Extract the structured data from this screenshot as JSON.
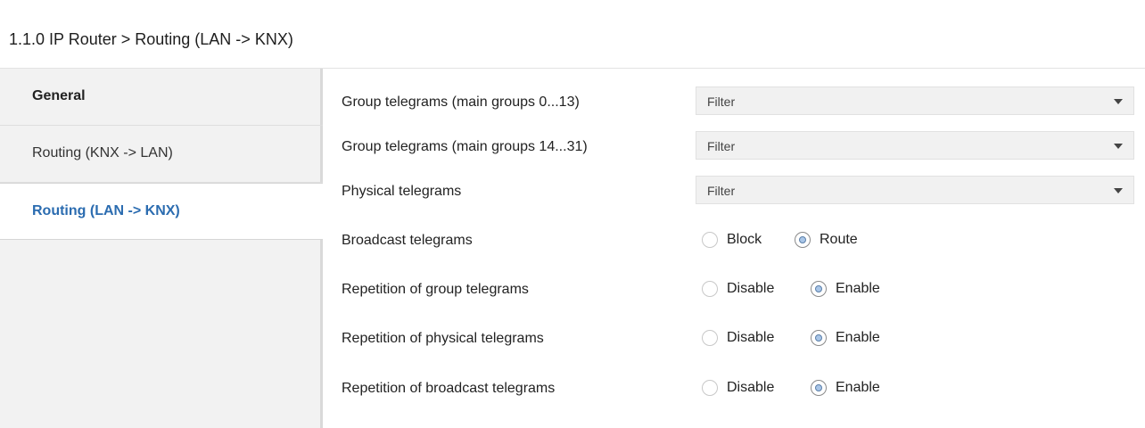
{
  "header": {
    "title": "1.1.0 IP Router > Routing (LAN -> KNX)"
  },
  "sidebar": {
    "items": [
      {
        "label": "General"
      },
      {
        "label": "Routing (KNX -> LAN)"
      },
      {
        "label": "Routing (LAN -> KNX)",
        "active": true
      }
    ]
  },
  "params": {
    "group_main_0_13": {
      "label": "Group telegrams (main groups 0...13)",
      "value": "Filter"
    },
    "group_main_14_31": {
      "label": "Group telegrams (main groups 14...31)",
      "value": "Filter"
    },
    "physical": {
      "label": "Physical telegrams",
      "value": "Filter"
    },
    "broadcast": {
      "label": "Broadcast telegrams",
      "options": [
        "Block",
        "Route"
      ],
      "selected": "Route"
    },
    "rep_group": {
      "label": "Repetition of group telegrams",
      "options": [
        "Disable",
        "Enable"
      ],
      "selected": "Enable"
    },
    "rep_physical": {
      "label": "Repetition of physical telegrams",
      "options": [
        "Disable",
        "Enable"
      ],
      "selected": "Enable"
    },
    "rep_broadcast": {
      "label": "Repetition of broadcast telegrams",
      "options": [
        "Disable",
        "Enable"
      ],
      "selected": "Enable"
    }
  },
  "colors": {
    "active_nav": "#2b6cb0",
    "sidebar_bg": "#f2f2f2",
    "dropdown_bg": "#f1f1f1",
    "radio_fill": "#a9c6e8"
  },
  "icons": {
    "dropdown": "caret-down-icon",
    "radio": "radio-button-icon"
  }
}
